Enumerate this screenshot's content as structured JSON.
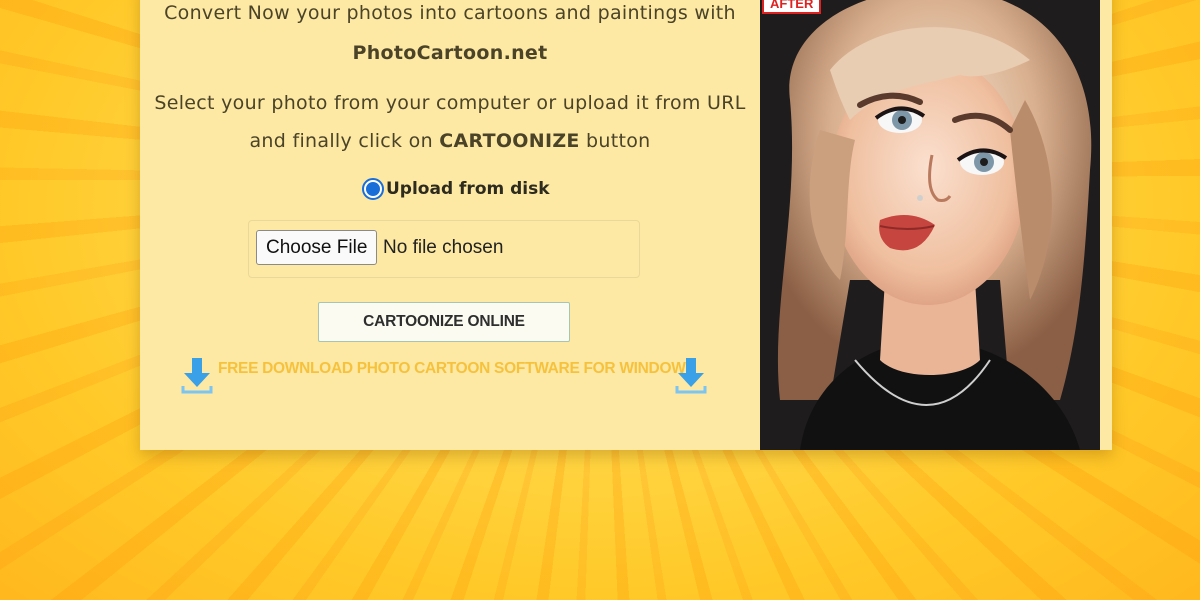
{
  "intro": {
    "line1": "Convert Now your photos into cartoons and paintings with",
    "site_name": "PhotoCartoon.net",
    "line3": "Select your photo from your computer or upload it from URL",
    "line4_prefix": "and finally click on ",
    "line4_bold": "CARTOONIZE",
    "line4_suffix": " button"
  },
  "upload_option": {
    "label": "Upload from disk",
    "selected": true
  },
  "file_input": {
    "button_label": "Choose File",
    "status": "No file chosen"
  },
  "cartoonize_button": {
    "label": "CARTOONIZE ONLINE"
  },
  "download_link": {
    "label": "FREE DOWNLOAD PHOTO CARTOON SOFTWARE FOR WINDOWS"
  },
  "preview": {
    "tag": "AFTER"
  },
  "colors": {
    "card_bg": "#fde9a3",
    "radio_accent": "#1a6ed8",
    "download_link": "#f6c23e",
    "arrow_icon": "#3aa0e8",
    "after_tag": "#dd2222"
  },
  "icons": {
    "download": "download-arrow-icon"
  }
}
